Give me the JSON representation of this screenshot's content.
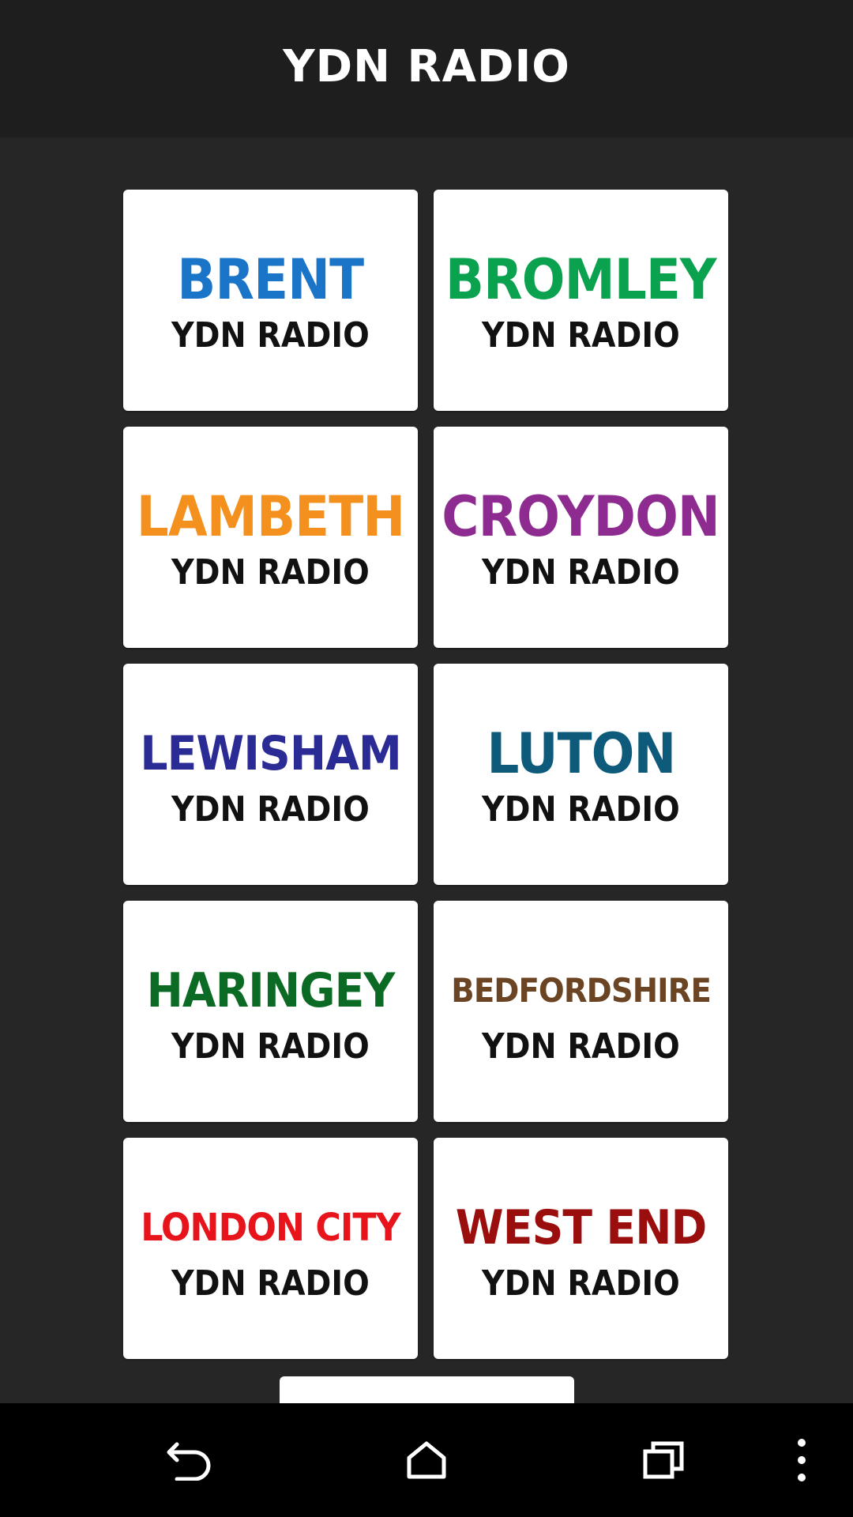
{
  "header": {
    "title": "YDN RADIO"
  },
  "stations": [
    {
      "name": "BRENT",
      "sub": "YDN RADIO",
      "color": "#1a74c7"
    },
    {
      "name": "BROMLEY",
      "sub": "YDN RADIO",
      "color": "#0aa14f"
    },
    {
      "name": "LAMBETH",
      "sub": "YDN RADIO",
      "color": "#f4911e"
    },
    {
      "name": "CROYDON",
      "sub": "YDN RADIO",
      "color": "#8e2b91"
    },
    {
      "name": "LEWISHAM",
      "sub": "YDN RADIO",
      "color": "#2b2b95"
    },
    {
      "name": "LUTON",
      "sub": "YDN RADIO",
      "color": "#0d5a7a"
    },
    {
      "name": "HARINGEY",
      "sub": "YDN RADIO",
      "color": "#0b6b24"
    },
    {
      "name": "BEDFORDSHIRE",
      "sub": "YDN RADIO",
      "color": "#6b4423"
    },
    {
      "name": "LONDON CITY",
      "sub": "YDN RADIO",
      "color": "#e8141b"
    },
    {
      "name": "WEST END",
      "sub": "YDN RADIO",
      "color": "#9a0e0e"
    }
  ],
  "navbar": {
    "icons": [
      "back-icon",
      "home-icon",
      "recent-apps-icon",
      "overflow-menu-icon"
    ]
  }
}
